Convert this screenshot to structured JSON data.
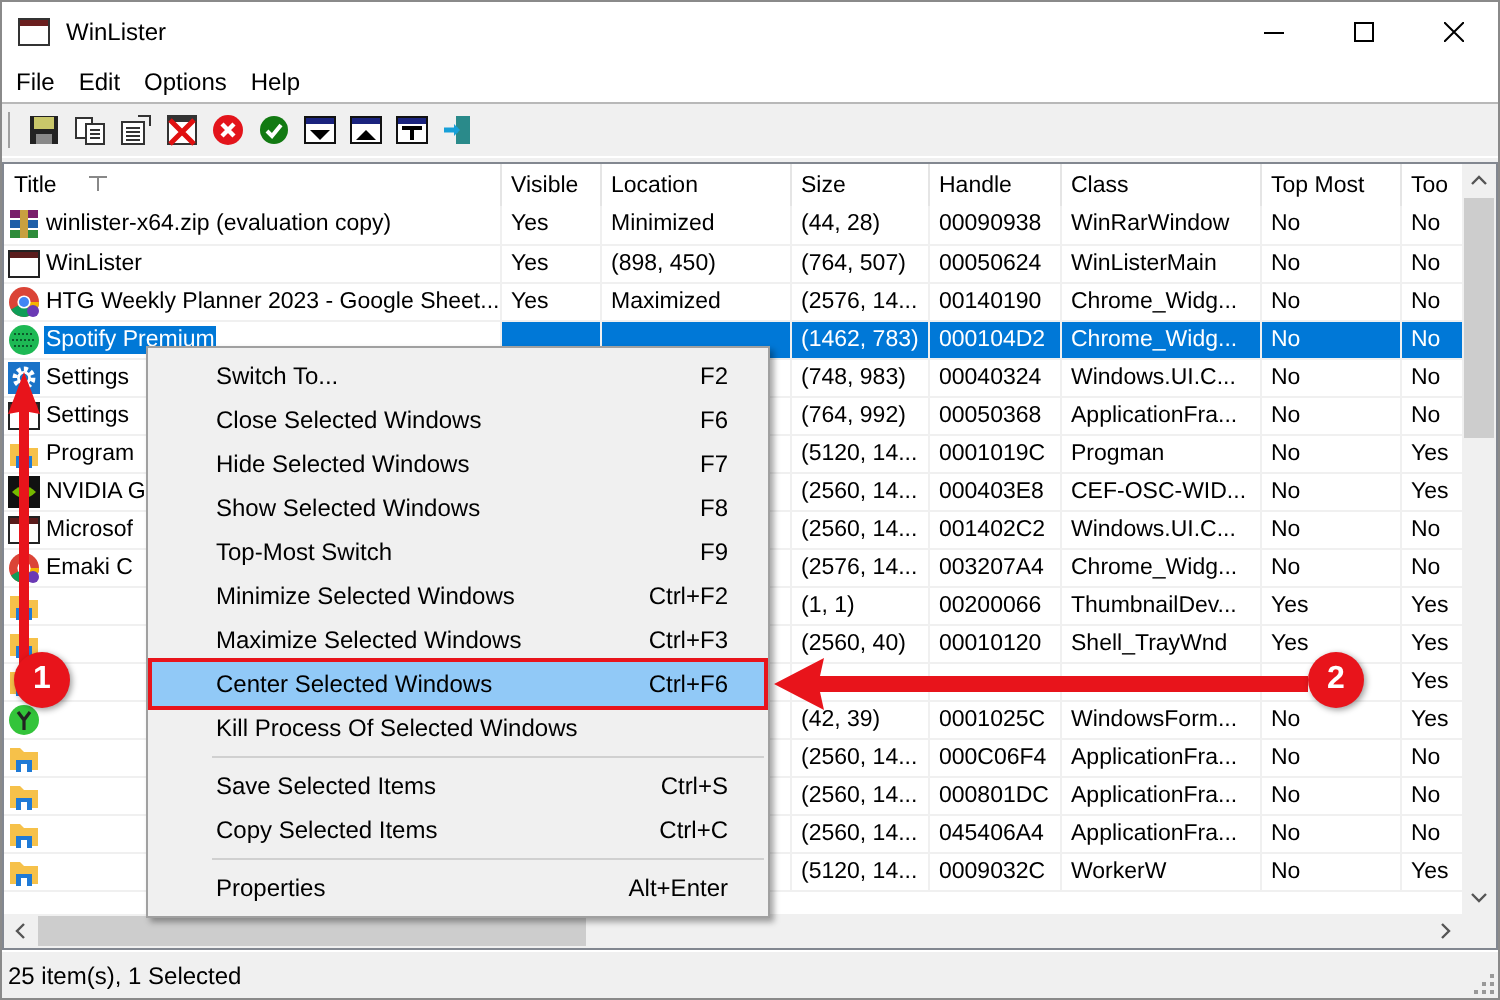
{
  "window": {
    "title": "WinLister"
  },
  "menu_bar": [
    "File",
    "Edit",
    "Options",
    "Help"
  ],
  "columns": [
    "Title",
    "Visible",
    "Location",
    "Size",
    "Handle",
    "Class",
    "Top Most",
    "Too"
  ],
  "rows": [
    {
      "kind": "archive",
      "selected": false,
      "title": "winlister-x64.zip (evaluation copy)",
      "visible": "Yes",
      "location": "Minimized",
      "size": "(44, 28)",
      "handle": "00090938",
      "class": "WinRarWindow",
      "top_most": "No",
      "column_8": "No"
    },
    {
      "kind": "window",
      "selected": false,
      "title": "WinLister",
      "visible": "Yes",
      "location": "(898, 450)",
      "size": "(764, 507)",
      "handle": "00050624",
      "class": "WinListerMain",
      "top_most": "No",
      "column_8": "No"
    },
    {
      "kind": "browser",
      "selected": false,
      "title": "HTG Weekly Planner 2023 - Google Sheet...",
      "visible": "Yes",
      "location": "Maximized",
      "size": "(2576, 14...",
      "handle": "00140190",
      "class": "Chrome_Widg...",
      "top_most": "No",
      "column_8": "No"
    },
    {
      "kind": "globe",
      "selected": true,
      "title": "Spotify Premium",
      "size": "(1462, 783)",
      "handle": "000104D2",
      "class": "Chrome_Widg...",
      "top_most": "No",
      "column_8": "No"
    },
    {
      "kind": "gear",
      "selected": false,
      "title": "Settings",
      "size": "(748, 983)",
      "handle": "00040324",
      "class": "Windows.UI.C...",
      "top_most": "No",
      "column_8": "No"
    },
    {
      "kind": "window",
      "selected": false,
      "title": "Settings",
      "size": "(764, 992)",
      "handle": "00050368",
      "class": "ApplicationFra...",
      "top_most": "No",
      "column_8": "No"
    },
    {
      "kind": "folder",
      "selected": false,
      "title": "Program",
      "size": "(5120, 14...",
      "handle": "0001019C",
      "class": "Progman",
      "top_most": "No",
      "column_8": "Yes"
    },
    {
      "kind": "gpu",
      "selected": false,
      "title": "NVIDIA G",
      "size": "(2560, 14...",
      "handle": "000403E8",
      "class": "CEF-OSC-WID...",
      "top_most": "No",
      "column_8": "Yes"
    },
    {
      "kind": "window",
      "selected": false,
      "title": "Microsof",
      "size": "(2560, 14...",
      "handle": "001402C2",
      "class": "Windows.UI.C...",
      "top_most": "No",
      "column_8": "No"
    },
    {
      "kind": "browser",
      "selected": false,
      "title": "Emaki C",
      "size": "(2576, 14...",
      "handle": "003207A4",
      "class": "Chrome_Widg...",
      "top_most": "No",
      "column_8": "No"
    },
    {
      "kind": "folder",
      "selected": false,
      "size": "(1, 1)",
      "handle": "00200066",
      "class": "ThumbnailDev...",
      "top_most": "Yes",
      "column_8": "Yes"
    },
    {
      "kind": "folder",
      "selected": false,
      "size": "(2560, 40)",
      "handle": "00010120",
      "class": "Shell_TrayWnd",
      "top_most": "Yes",
      "column_8": "Yes"
    },
    {
      "kind": "folder",
      "selected": false,
      "column_8": "Yes"
    },
    {
      "kind": "tool",
      "selected": false,
      "size": "(42, 39)",
      "handle": "0001025C",
      "class": "WindowsForm...",
      "top_most": "No",
      "column_8": "Yes"
    },
    {
      "kind": "folder",
      "selected": false,
      "size": "(2560, 14...",
      "handle": "000C06F4",
      "class": "ApplicationFra...",
      "top_most": "No",
      "column_8": "No"
    },
    {
      "kind": "folder",
      "selected": false,
      "size": "(2560, 14...",
      "handle": "000801DC",
      "class": "ApplicationFra...",
      "top_most": "No",
      "column_8": "No"
    },
    {
      "kind": "folder",
      "selected": false,
      "size": "(2560, 14...",
      "handle": "045406A4",
      "class": "ApplicationFra...",
      "top_most": "No",
      "column_8": "No"
    },
    {
      "kind": "folder",
      "selected": false,
      "size": "(5120, 14...",
      "handle": "0009032C",
      "class": "WorkerW",
      "top_most": "No",
      "column_8": "Yes"
    }
  ],
  "context_menu": [
    [
      {
        "label": "Switch To...",
        "shortcut": "F2",
        "selected": false
      },
      {
        "label": "Close Selected Windows",
        "shortcut": "F6",
        "selected": false
      },
      {
        "label": "Hide Selected Windows",
        "shortcut": "F7",
        "selected": false
      },
      {
        "label": "Show Selected Windows",
        "shortcut": "F8",
        "selected": false
      },
      {
        "label": "Top-Most Switch",
        "shortcut": "F9",
        "selected": false
      },
      {
        "label": "Minimize Selected Windows",
        "shortcut": "Ctrl+F2",
        "selected": false
      },
      {
        "label": "Maximize Selected Windows",
        "shortcut": "Ctrl+F3",
        "selected": false
      },
      {
        "label": "Center Selected Windows",
        "shortcut": "Ctrl+F6",
        "selected": true
      },
      {
        "label": "Kill Process Of Selected Windows",
        "selected": false
      }
    ],
    [
      {
        "label": "Save Selected Items",
        "shortcut": "Ctrl+S",
        "selected": false
      },
      {
        "label": "Copy Selected Items",
        "shortcut": "Ctrl+C",
        "selected": false
      }
    ],
    [
      {
        "label": "Properties",
        "shortcut": "Alt+Enter",
        "selected": false
      }
    ]
  ],
  "annotations": [
    {
      "label": "1"
    },
    {
      "label": "2"
    }
  ],
  "status_bar": "25 item(s), 1 Selected"
}
